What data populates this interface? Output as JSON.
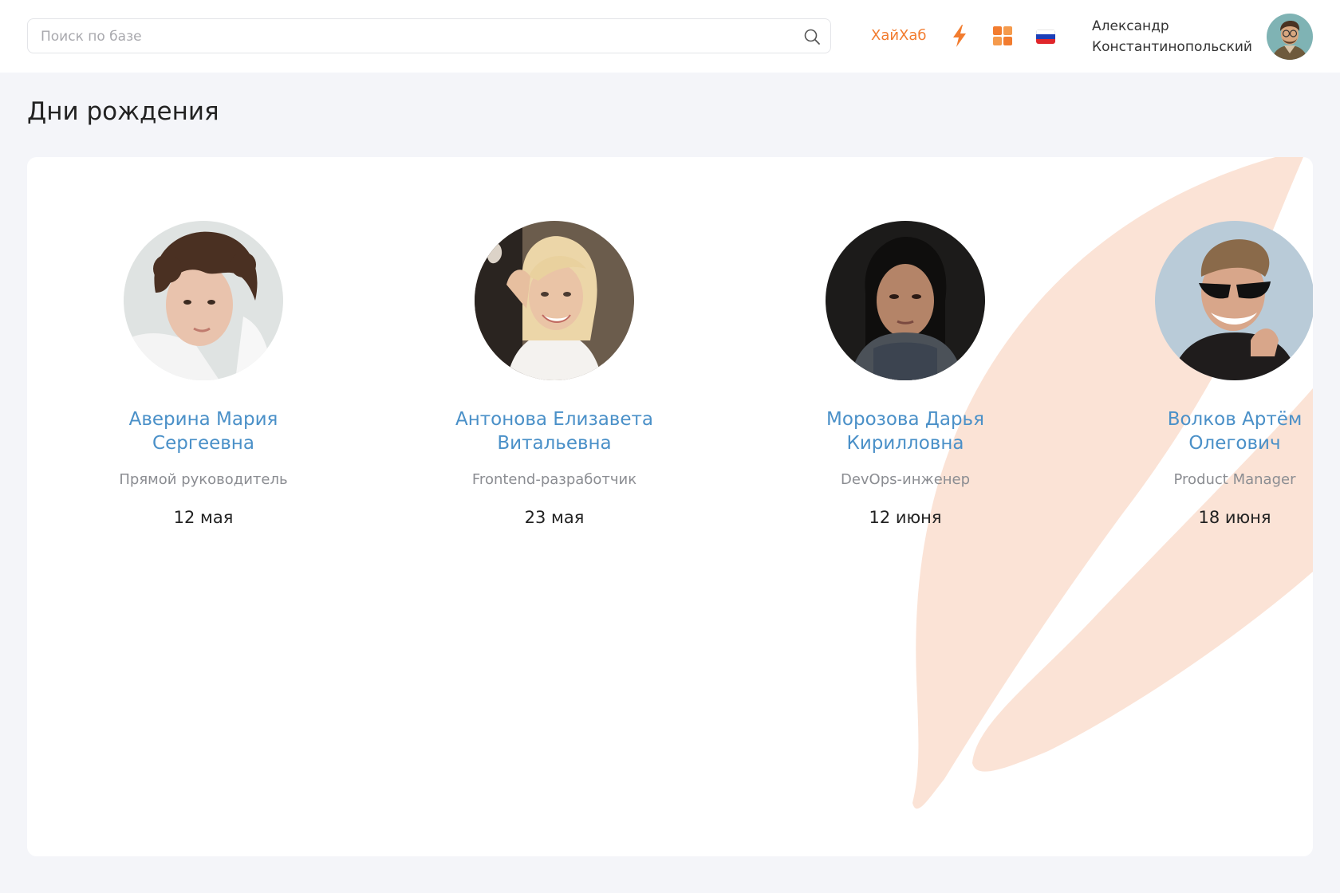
{
  "header": {
    "search": {
      "placeholder": "Поиск по базе",
      "value": ""
    },
    "brand_link": "ХайХаб",
    "user": {
      "first_name": "Александр",
      "last_name": "Константинопольский"
    },
    "colors": {
      "accent": "#f27c2f",
      "link": "#4a90c8",
      "flag": [
        "#ffffff",
        "#1c3fb8",
        "#e0262b"
      ]
    }
  },
  "page": {
    "title": "Дни рождения"
  },
  "birthdays": [
    {
      "name_line1": "Аверина Мария",
      "name_line2": "Сергеевна",
      "role": "Прямой руководитель",
      "date": "12 мая"
    },
    {
      "name_line1": "Антонова Елизавета",
      "name_line2": "Витальевна",
      "role": "Frontend-разработчик",
      "date": "23 мая"
    },
    {
      "name_line1": "Морозова Дарья",
      "name_line2": "Кирилловна",
      "role": "DevOps-инженер",
      "date": "12 июня"
    },
    {
      "name_line1": "Волков Артём",
      "name_line2": "Олегович",
      "role": "Product Manager",
      "date": "18 июня"
    }
  ]
}
